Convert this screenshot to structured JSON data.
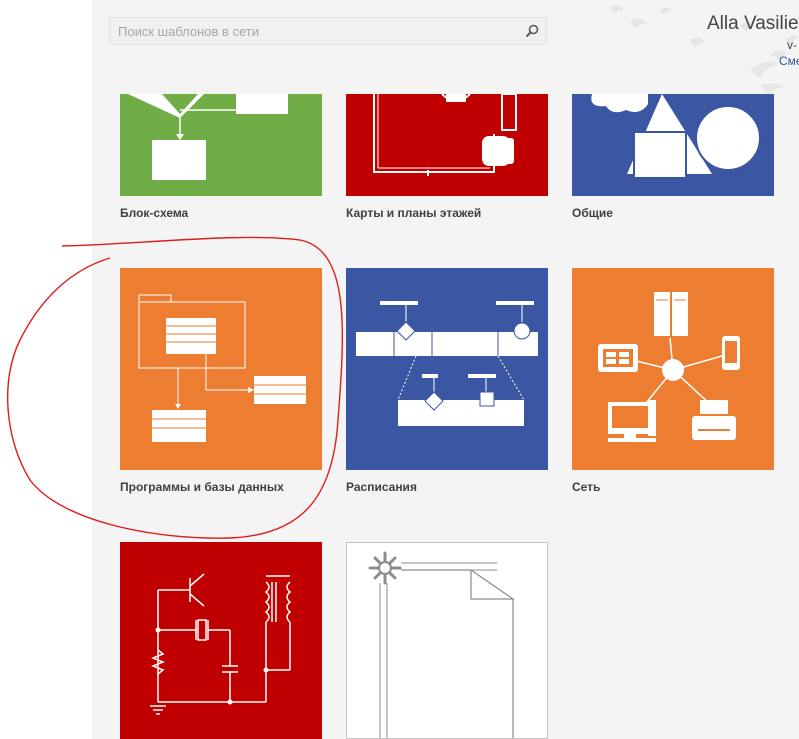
{
  "search": {
    "placeholder": "Поиск шаблонов в сети"
  },
  "user": {
    "name": "Alla Vasiliev",
    "email_fragment": "v-",
    "switch_link": "Сме"
  },
  "templates": [
    {
      "label": "Блок-схема",
      "color": "#71ad47"
    },
    {
      "label": "Карты и планы этажей",
      "color": "#c00000"
    },
    {
      "label": "Общие",
      "color": "#3b56a3"
    },
    {
      "label": "Программы и базы данных",
      "color": "#ed7d31"
    },
    {
      "label": "Расписания",
      "color": "#3b56a3"
    },
    {
      "label": "Сеть",
      "color": "#ed7d31"
    },
    {
      "label": "",
      "color": "#c00000"
    },
    {
      "label": "",
      "color": "#ffffff"
    }
  ],
  "annotation_color": "#e21b1b"
}
